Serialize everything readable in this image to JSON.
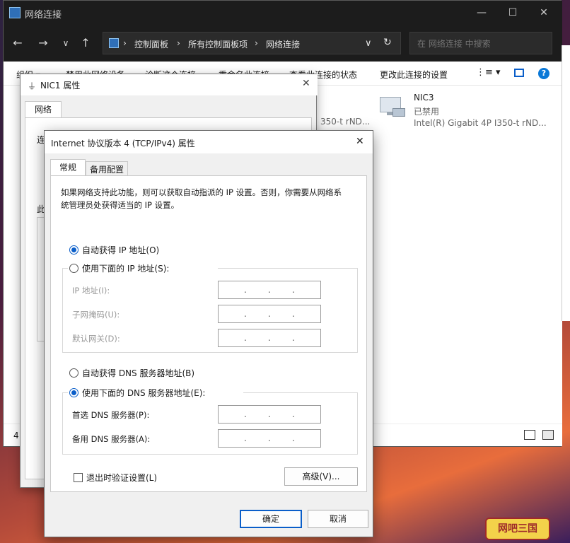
{
  "explorer": {
    "title": "网络连接",
    "window_controls": {
      "minimize": "—",
      "maximize": "☐",
      "close": "✕"
    },
    "path": [
      "控制面板",
      "所有控制面板项",
      "网络连接"
    ],
    "search_placeholder": "在 网络连接 中搜索",
    "toolbar": [
      "组织 ▾",
      "禁用此网络设备",
      "诊断这个连接",
      "重命名此连接",
      "查看此连接的状态",
      "更改此连接的设置"
    ],
    "status_count": "4",
    "adapter": {
      "name": "NIC3",
      "state": "已禁用",
      "device": "Intel(R) Gigabit 4P I350-t rND..."
    },
    "partial_adapter_device": "350-t rND..."
  },
  "nic1": {
    "title": "NIC1 属性",
    "tab": "网络",
    "partial_label_1": "连",
    "partial_label_2": "此"
  },
  "ipv4": {
    "title": "Internet 协议版本 4 (TCP/IPv4) 属性",
    "tabs": [
      "常规",
      "备用配置"
    ],
    "description": "如果网络支持此功能，则可以获取自动指派的 IP 设置。否则，你需要从网络系统管理员处获得适当的 IP 设置。",
    "radio_auto_ip": "自动获得 IP 地址(O)",
    "radio_manual_ip": "使用下面的 IP 地址(S):",
    "ip_label": "IP 地址(I):",
    "subnet_label": "子网掩码(U):",
    "gateway_label": "默认网关(D):",
    "radio_auto_dns": "自动获得 DNS 服务器地址(B)",
    "radio_manual_dns": "使用下面的 DNS 服务器地址(E):",
    "dns_primary_label": "首选 DNS 服务器(P):",
    "dns_alt_label": "备用 DNS 服务器(A):",
    "validate_label": "退出时验证设置(L)",
    "advanced_button": "高级(V)...",
    "ok_button": "确定",
    "cancel_button": "取消",
    "close": "✕"
  },
  "badge": "网吧三国",
  "colors": {
    "accent": "#0a5ec9",
    "titlebar": "#1c1c1c"
  }
}
